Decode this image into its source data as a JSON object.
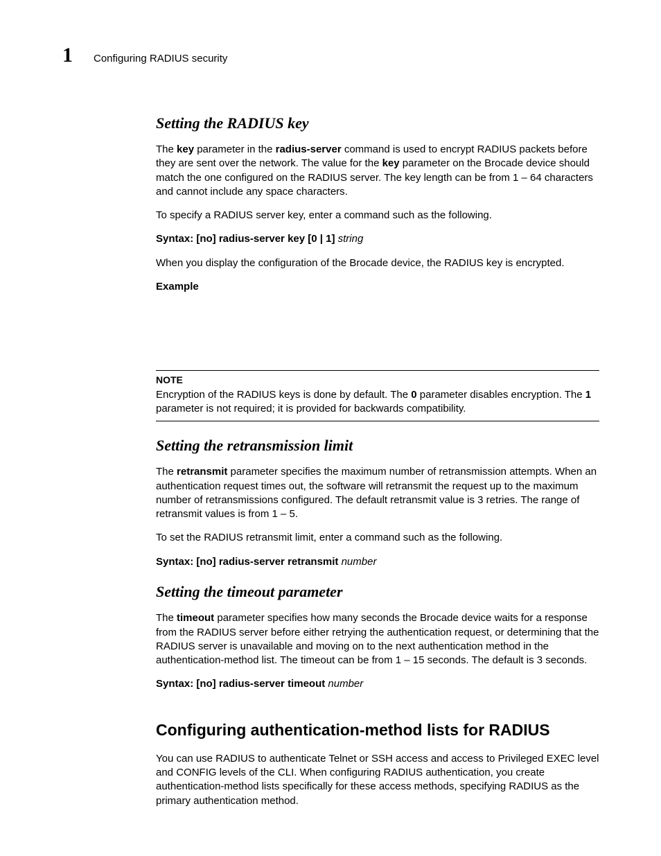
{
  "header": {
    "chapter_number": "1",
    "running_head": "Configuring RADIUS security"
  },
  "sections": {
    "radius_key": {
      "heading": "Setting the RADIUS key",
      "p1_a": "The ",
      "p1_b": "key",
      "p1_c": " parameter in the ",
      "p1_d": "radius-server",
      "p1_e": " command is used to encrypt RADIUS packets before they are sent over the network. The value for the ",
      "p1_f": "key",
      "p1_g": " parameter on the Brocade device should match the one configured on the RADIUS server. The key length can be from 1 – 64 characters and cannot include any space characters.",
      "p2": "To specify a RADIUS server key, enter a command such as the following.",
      "syntax_label": "Syntax:  ",
      "syntax_cmd": "[no] radius-server key [0 | 1] ",
      "syntax_arg": "string",
      "p3": "When you display the configuration of the Brocade device, the RADIUS key is encrypted.",
      "example_label": "Example"
    },
    "note": {
      "label": "NOTE",
      "t1": "Encryption of the RADIUS keys is done by default. The ",
      "t2": "0",
      "t3": " parameter disables encryption. The ",
      "t4": "1",
      "t5": " parameter is not required; it is provided for backwards compatibility."
    },
    "retransmit": {
      "heading": "Setting the retransmission limit",
      "p1_a": "The ",
      "p1_b": "retransmit",
      "p1_c": " parameter specifies the maximum number of retransmission attempts. When an authentication request times out, the software will retransmit the request up to the maximum number of retransmissions configured. The default retransmit value is 3 retries. The range of retransmit values is from 1 – 5.",
      "p2": "To set the RADIUS retransmit limit, enter a command such as the following.",
      "syntax_label": "Syntax:  ",
      "syntax_cmd": "[no] radius-server retransmit ",
      "syntax_arg": "number"
    },
    "timeout": {
      "heading": "Setting the timeout parameter",
      "p1_a": "The ",
      "p1_b": "timeout",
      "p1_c": " parameter specifies how many seconds the Brocade device waits for a response from the RADIUS server before either retrying the authentication request, or determining that the RADIUS server is unavailable and moving on to the next authentication method in the authentication-method list. The timeout can be from 1 – 15 seconds. The default is 3 seconds.",
      "syntax_label": "Syntax:  ",
      "syntax_cmd": "[no] radius-server timeout ",
      "syntax_arg": "number"
    },
    "authlists": {
      "heading": "Configuring authentication-method lists for RADIUS",
      "p1": "You can use RADIUS to authenticate Telnet or SSH access and access to Privileged EXEC level and CONFIG levels of the CLI. When configuring RADIUS authentication, you create authentication-method lists specifically for these access methods, specifying RADIUS as the primary authentication method."
    }
  }
}
